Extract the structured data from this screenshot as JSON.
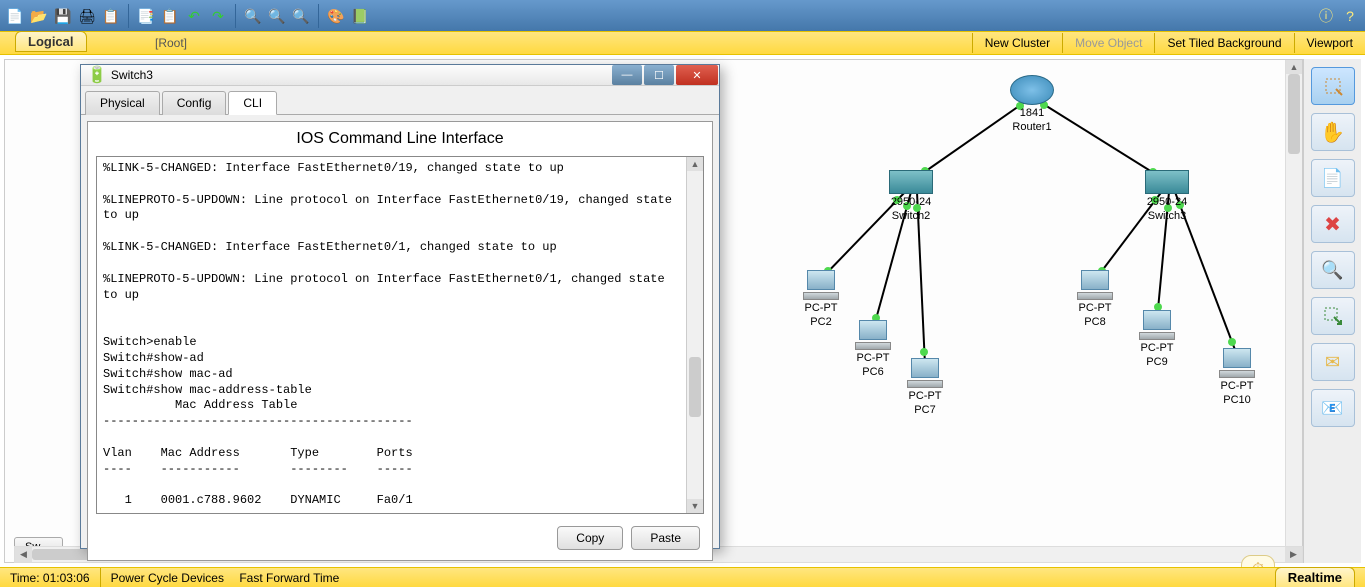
{
  "topbar": {
    "icons": [
      "new",
      "open",
      "save",
      "print",
      "wizard",
      "copy",
      "paste",
      "undo",
      "redo",
      "zoomin",
      "zoomreset",
      "zoomout",
      "palette",
      "custom"
    ],
    "right_icons": [
      "info",
      "help"
    ]
  },
  "yellowbar": {
    "logical": "Logical",
    "root": "[Root]",
    "new_cluster": "New Cluster",
    "move_object": "Move Object",
    "set_bg": "Set Tiled Background",
    "viewport": "Viewport"
  },
  "side_tools": [
    "select",
    "hand",
    "note",
    "delete",
    "inspect",
    "resize",
    "envelope-add",
    "envelope-plus"
  ],
  "topology": {
    "router": {
      "model": "1841",
      "name": "Router1"
    },
    "switch2": {
      "model": "2950-24",
      "name": "Switch2"
    },
    "switch3": {
      "model": "2950-24",
      "name": "Switch3"
    },
    "pcs": [
      {
        "type": "PC-PT",
        "name": "PC2"
      },
      {
        "type": "PC-PT",
        "name": "PC6"
      },
      {
        "type": "PC-PT",
        "name": "PC7"
      },
      {
        "type": "PC-PT",
        "name": "PC8"
      },
      {
        "type": "PC-PT",
        "name": "PC9"
      },
      {
        "type": "PC-PT",
        "name": "PC10"
      }
    ]
  },
  "canvas_tab": "Sw",
  "modal": {
    "title": "Switch3",
    "tabs": {
      "physical": "Physical",
      "config": "Config",
      "cli": "CLI"
    },
    "cli_heading": "IOS Command Line Interface",
    "cli_text": "%LINK-5-CHANGED: Interface FastEthernet0/19, changed state to up\n\n%LINEPROTO-5-UPDOWN: Line protocol on Interface FastEthernet0/19, changed state to up\n\n%LINK-5-CHANGED: Interface FastEthernet0/1, changed state to up\n\n%LINEPROTO-5-UPDOWN: Line protocol on Interface FastEthernet0/1, changed state to up\n\n\nSwitch>enable\nSwitch#show-ad\nSwitch#show mac-ad\nSwitch#show mac-address-table \n          Mac Address Table\n-------------------------------------------\n\nVlan    Mac Address       Type        Ports\n----    -----------       --------    -----\n\n   1    0001.c788.9602    DYNAMIC     Fa0/1",
    "copy": "Copy",
    "paste": "Paste"
  },
  "status": {
    "time_label": "Time: 01:03:06",
    "power_cycle": "Power Cycle Devices",
    "ff_time": "Fast Forward Time",
    "realtime": "Realtime"
  }
}
